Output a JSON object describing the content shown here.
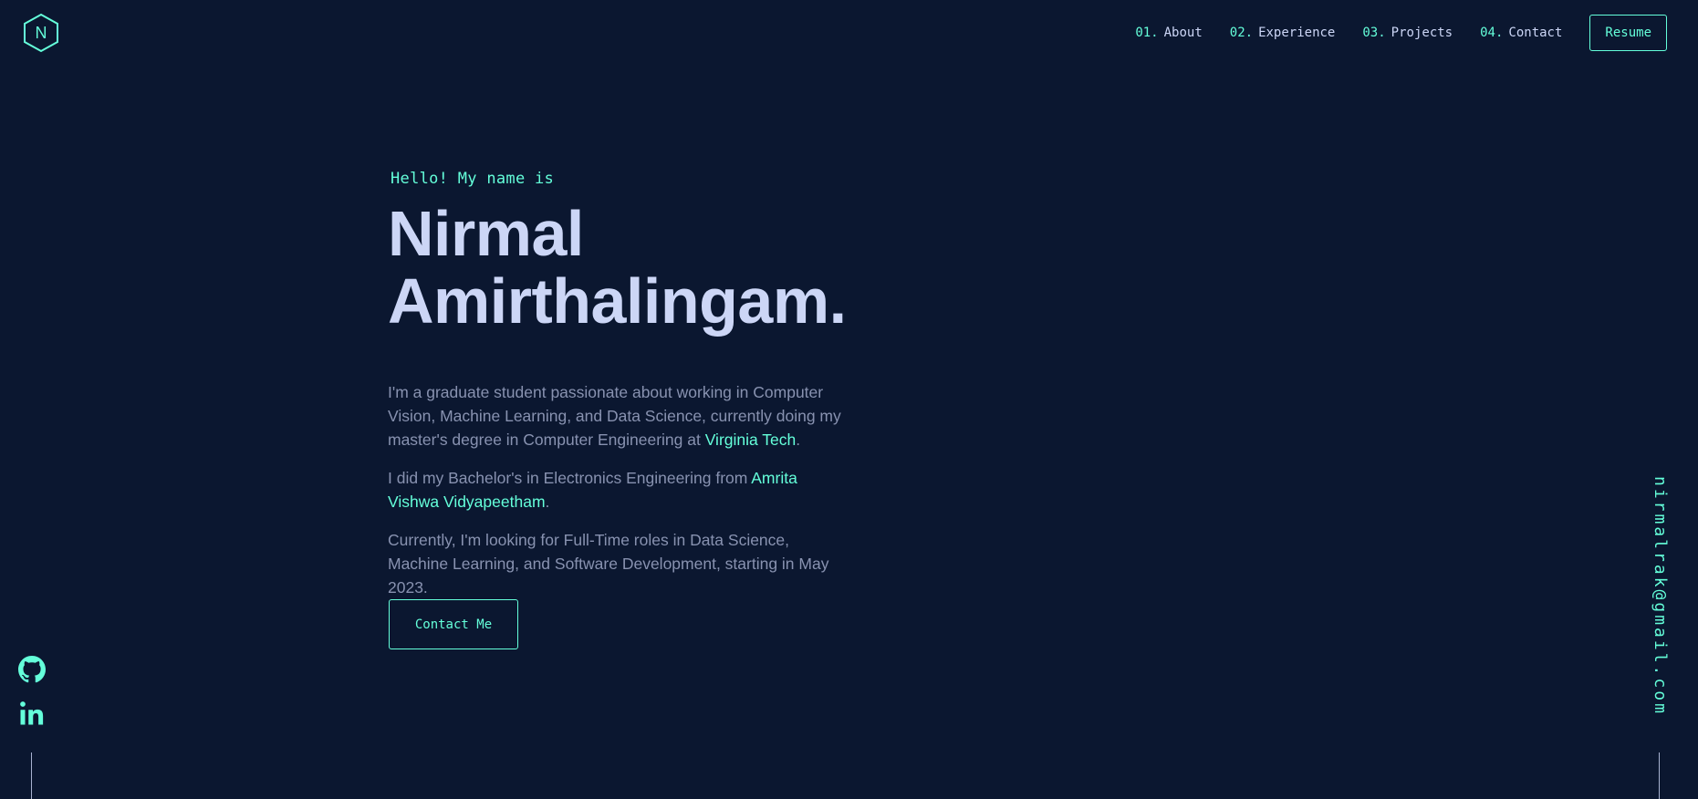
{
  "header": {
    "logo_letter": "N",
    "nav": [
      {
        "num": "01.",
        "label": "About"
      },
      {
        "num": "02.",
        "label": "Experience"
      },
      {
        "num": "03.",
        "label": "Projects"
      },
      {
        "num": "04.",
        "label": "Contact"
      }
    ],
    "resume_label": "Resume"
  },
  "hero": {
    "greeting": "Hello! My name is",
    "name": "Nirmal Amirthalingam.",
    "bio1_pre": "I'm a graduate student passionate about working in Computer Vision, Machine Learning, and Data Science, currently doing my master's degree in Computer Engineering at ",
    "bio1_link": "Virginia Tech",
    "bio1_post": ".",
    "bio2_pre": "I did my Bachelor's in Electronics Engineering from ",
    "bio2_link": "Amrita Vishwa Vidyapeetham",
    "bio2_post": ".",
    "bio3": "Currently, I'm looking for Full-Time roles in Data Science, Machine Learning, and Software Development, starting in May 2023.",
    "contact_label": "Contact Me"
  },
  "sidebar": {
    "email": "nirmalrak@gmail.com",
    "icons": [
      "github-icon",
      "linkedin-icon"
    ]
  },
  "colors": {
    "background": "#0b1730",
    "accent": "#64ffda",
    "heading": "#ccd6f6",
    "body_text": "#8892b0"
  }
}
